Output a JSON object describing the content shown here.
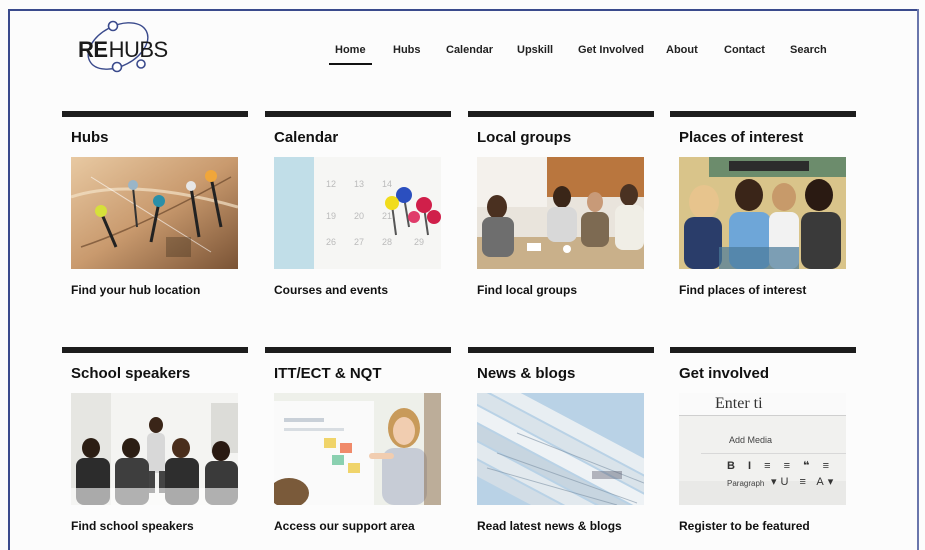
{
  "logo": {
    "re": "RE",
    "hubs": "HUBS"
  },
  "nav": [
    {
      "label": "Home",
      "active": true
    },
    {
      "label": "Hubs"
    },
    {
      "label": "Calendar"
    },
    {
      "label": "Upskill"
    },
    {
      "label": "Get Involved"
    },
    {
      "label": "About"
    },
    {
      "label": "Contact"
    },
    {
      "label": "Search"
    }
  ],
  "cards": [
    {
      "title": "Hubs",
      "link": "Find your hub location",
      "image": "map-pins-photo"
    },
    {
      "title": "Calendar",
      "link": "Courses and events",
      "image": "calendar-pins-photo"
    },
    {
      "title": "Local groups",
      "link": "Find local groups",
      "image": "group-meeting-photo"
    },
    {
      "title": "Places of interest",
      "link": "Find places of interest",
      "image": "children-photo"
    },
    {
      "title": "School speakers",
      "link": "Find school speakers",
      "image": "presentation-photo"
    },
    {
      "title": "ITT/ECT & NQT",
      "link": "Access our support area",
      "image": "teacher-whiteboard-photo"
    },
    {
      "title": "News & blogs",
      "link": "Read latest news & blogs",
      "image": "newspapers-photo"
    },
    {
      "title": "Get involved",
      "link": "Register to be featured",
      "image": "editor-screen-photo"
    }
  ],
  "editor_snippet": {
    "enter": "Enter ti",
    "add_media": "Add Media",
    "paragraph": "Paragraph"
  },
  "colors": {
    "accent": "#3a4a8c",
    "bar": "#1d1d1d",
    "logo_ring": "#3a4a8c"
  }
}
